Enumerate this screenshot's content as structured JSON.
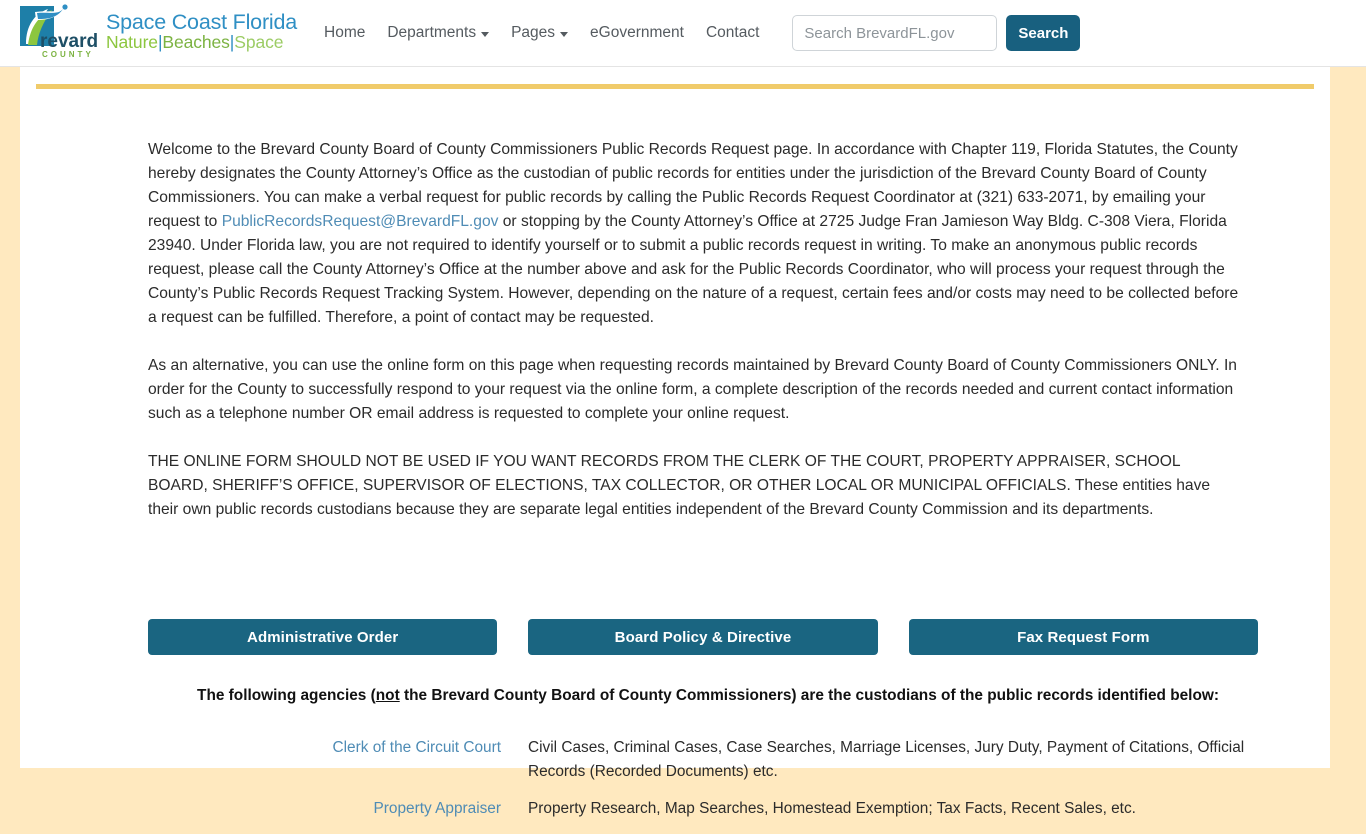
{
  "header": {
    "brand": {
      "logo_icon": "brevard-county-logo-icon",
      "logo_word": "revard",
      "logo_sub": "C O U N T Y",
      "tagline_line1": "Space Coast Florida",
      "tagline_nature": "Nature",
      "tagline_sep1": "|",
      "tagline_beaches": "Beaches",
      "tagline_sep2": "|",
      "tagline_space": "Space"
    },
    "nav": [
      {
        "label": "Home",
        "has_caret": false
      },
      {
        "label": "Departments",
        "has_caret": true
      },
      {
        "label": "Pages",
        "has_caret": true
      },
      {
        "label": "eGovernment",
        "has_caret": false
      },
      {
        "label": "Contact",
        "has_caret": false
      }
    ],
    "search": {
      "placeholder": "Search BrevardFL.gov",
      "value": "",
      "button_label": "Search"
    }
  },
  "main": {
    "paragraph1_part1": "Welcome to the Brevard County Board of County Commissioners Public Records Request page. In accordance with Chapter 119, Florida Statutes, the County hereby designates the County Attorney’s Office as the custodian of public records for entities under the jurisdiction of the Brevard County Board of County Commissioners. You can make a verbal request for public records by calling the Public Records Request Coordinator at (321) 633-2071, by emailing your request to ",
    "paragraph1_email": "PublicRecordsRequest@BrevardFL.gov",
    "paragraph1_part2": " or stopping by the County Attorney’s Office at 2725 Judge Fran Jamieson Way Bldg. C-308 Viera, Florida 23940. Under Florida law, you are not required to identify yourself or to submit a public records request in writing. To make an anonymous public records request, please call the County Attorney’s Office at the number above and ask for the Public Records Coordinator, who will process your request through the County’s Public Records Request Tracking System. However, depending on the nature of a request, certain fees and/or costs may need to be collected before a request can be fulfilled. Therefore, a point of contact may be requested.",
    "paragraph2": "As an alternative, you can use the online form on this page when requesting records maintained by Brevard County Board of County Commissioners ONLY. In order for the County to successfully respond to your request via the online form, a complete description of the records needed and current contact information such as a telephone number OR email address is requested to complete your online request.",
    "paragraph3": "THE ONLINE FORM SHOULD NOT BE USED IF YOU WANT RECORDS FROM THE CLERK OF THE COURT, PROPERTY APPRAISER, SCHOOL BOARD, SHERIFF’S OFFICE, SUPERVISOR OF ELECTIONS, TAX COLLECTOR, OR OTHER LOCAL OR MUNICIPAL OFFICIALS. These entities have their own public records custodians because they are separate legal entities independent of the Brevard County Commission and its departments.",
    "buttons": [
      {
        "label": "Administrative Order"
      },
      {
        "label": "Board Policy & Directive"
      },
      {
        "label": "Fax Request Form"
      }
    ],
    "agencies_heading_part1": "The following agencies (",
    "agencies_heading_underlined": "not",
    "agencies_heading_part2": " the Brevard County Board of County Commissioners) are the custodians of the public records identified below:",
    "agencies": [
      {
        "name": "Clerk of the Circuit Court",
        "records": "Civil Cases, Criminal Cases, Case Searches, Marriage Licenses, Jury Duty, Payment of Citations, Official Records (Recorded Documents) etc."
      },
      {
        "name": "Property Appraiser",
        "records": "Property Research, Map Searches, Homestead Exemption; Tax Facts, Recent Sales, etc."
      }
    ]
  },
  "colors": {
    "accent_teal": "#1a6581",
    "brand_blue": "#2f8fc4",
    "brand_green": "#7cb342",
    "gold_rule": "#f0cb6a",
    "page_bg": "#ffe9bf",
    "link": "#4f8cb5"
  }
}
